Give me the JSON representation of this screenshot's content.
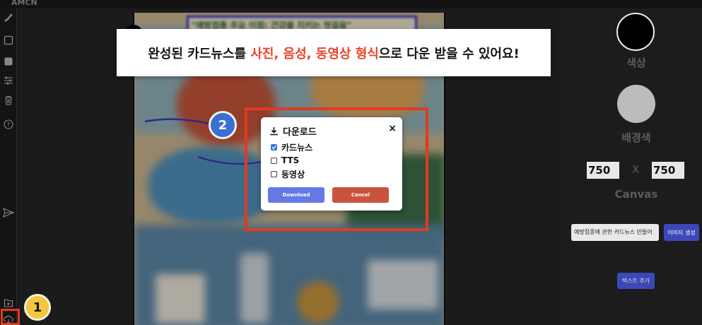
{
  "app": {
    "title": "AMCN"
  },
  "banner": {
    "text_before": "완성된 카드뉴스를 ",
    "text_highlight": "사진, 음성, 동영상 형식",
    "text_after": "으로 다운 받을 수 있어요!",
    "highlight_color": "#e8442a"
  },
  "canvas": {
    "title_text": "\"예방접종 주요 이점: 건강을 지키는 첫걸음\""
  },
  "download_modal": {
    "title": "다운로드",
    "close_label": "×",
    "options": [
      {
        "label": "카드뉴스",
        "checked": true
      },
      {
        "label": "TTS",
        "checked": false
      },
      {
        "label": "동영상",
        "checked": false
      }
    ],
    "download_label": "Download",
    "cancel_label": "Cancel"
  },
  "badges": {
    "step1": "1",
    "step2": "2"
  },
  "right_panel": {
    "color_label": "색상",
    "bg_color_label": "배경색",
    "canvas_width": "750",
    "canvas_height": "750",
    "x_label": "X",
    "canvas_label": "Canvas",
    "topic_input_value": "예방접종에 관한 카드뉴스 만들어",
    "generate_image_label": "이미지 생성",
    "add_text_label": "텍스트 추가"
  },
  "colors": {
    "highlight_border": "#e03a22",
    "accent_blue": "#3c48b8",
    "download_btn": "#6478e6",
    "cancel_btn": "#c9533d"
  },
  "icons": [
    "brush-icon",
    "rectangle-outline-icon",
    "rectangle-filled-icon",
    "sliders-icon",
    "trash-icon",
    "help-icon",
    "send-icon",
    "add-file-icon",
    "download-cloud-icon",
    "speaker-icon",
    "download-icon",
    "close-icon"
  ]
}
